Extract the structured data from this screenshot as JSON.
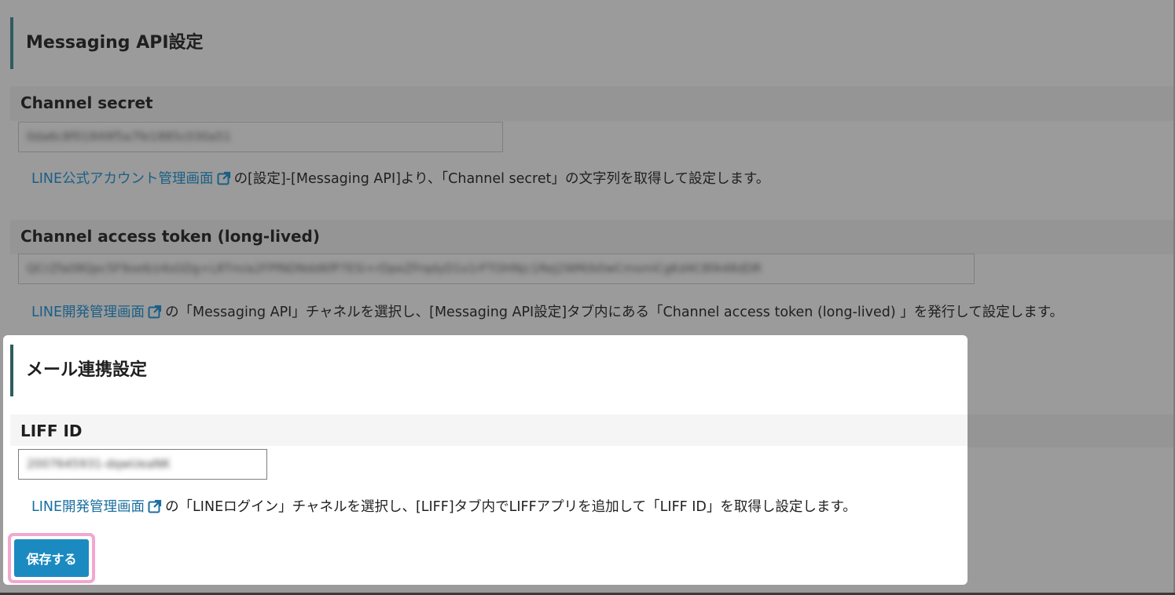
{
  "messaging": {
    "title": "Messaging API設定",
    "channel_secret": {
      "label": "Channel secret",
      "value": "0da6c8f01849f5a7fe1885c030a51",
      "help_link": "LINE公式アカウント管理画面",
      "help_text": "の[設定]-[Messaging API]より、「Channel secret」の文字列を取得して設定します。"
    },
    "access_token": {
      "label": "Channel access token (long-lived)",
      "value": "QCrZfa08Qpc5F9oe6/z4sGDg+L8Tm/a2FPfNDNdd6fP7ESi+rDpeZFrqdyD1x1rFTOHNjc1ReJ2WM/b0wCmsmiCgKd4C8fA48dDR",
      "help_link": "LINE開発管理画面",
      "help_text": "の「Messaging API」チャネルを選択し、[Messaging API設定]タブ内にある「Channel access token (long-lived) 」を発行して設定します。"
    }
  },
  "mail": {
    "title": "メール連携設定",
    "liff": {
      "label": "LIFF ID",
      "value": "2007645931-dqwUeaNK",
      "help_link": "LINE開発管理画面",
      "help_text": "の「LINEログイン」チャネルを選択し、[LIFF]タブ内でLIFFアプリを追加して「LIFF ID」を取得し設定します。"
    },
    "save_label": "保存する"
  },
  "icons": {
    "external": "external-link-icon"
  },
  "colors": {
    "link": "#1a6fa0",
    "button": "#1b8ac1",
    "highlight": "#f2a7cf",
    "accent_bar": "#2f5c5e",
    "overlay": "#9b9b9b"
  }
}
